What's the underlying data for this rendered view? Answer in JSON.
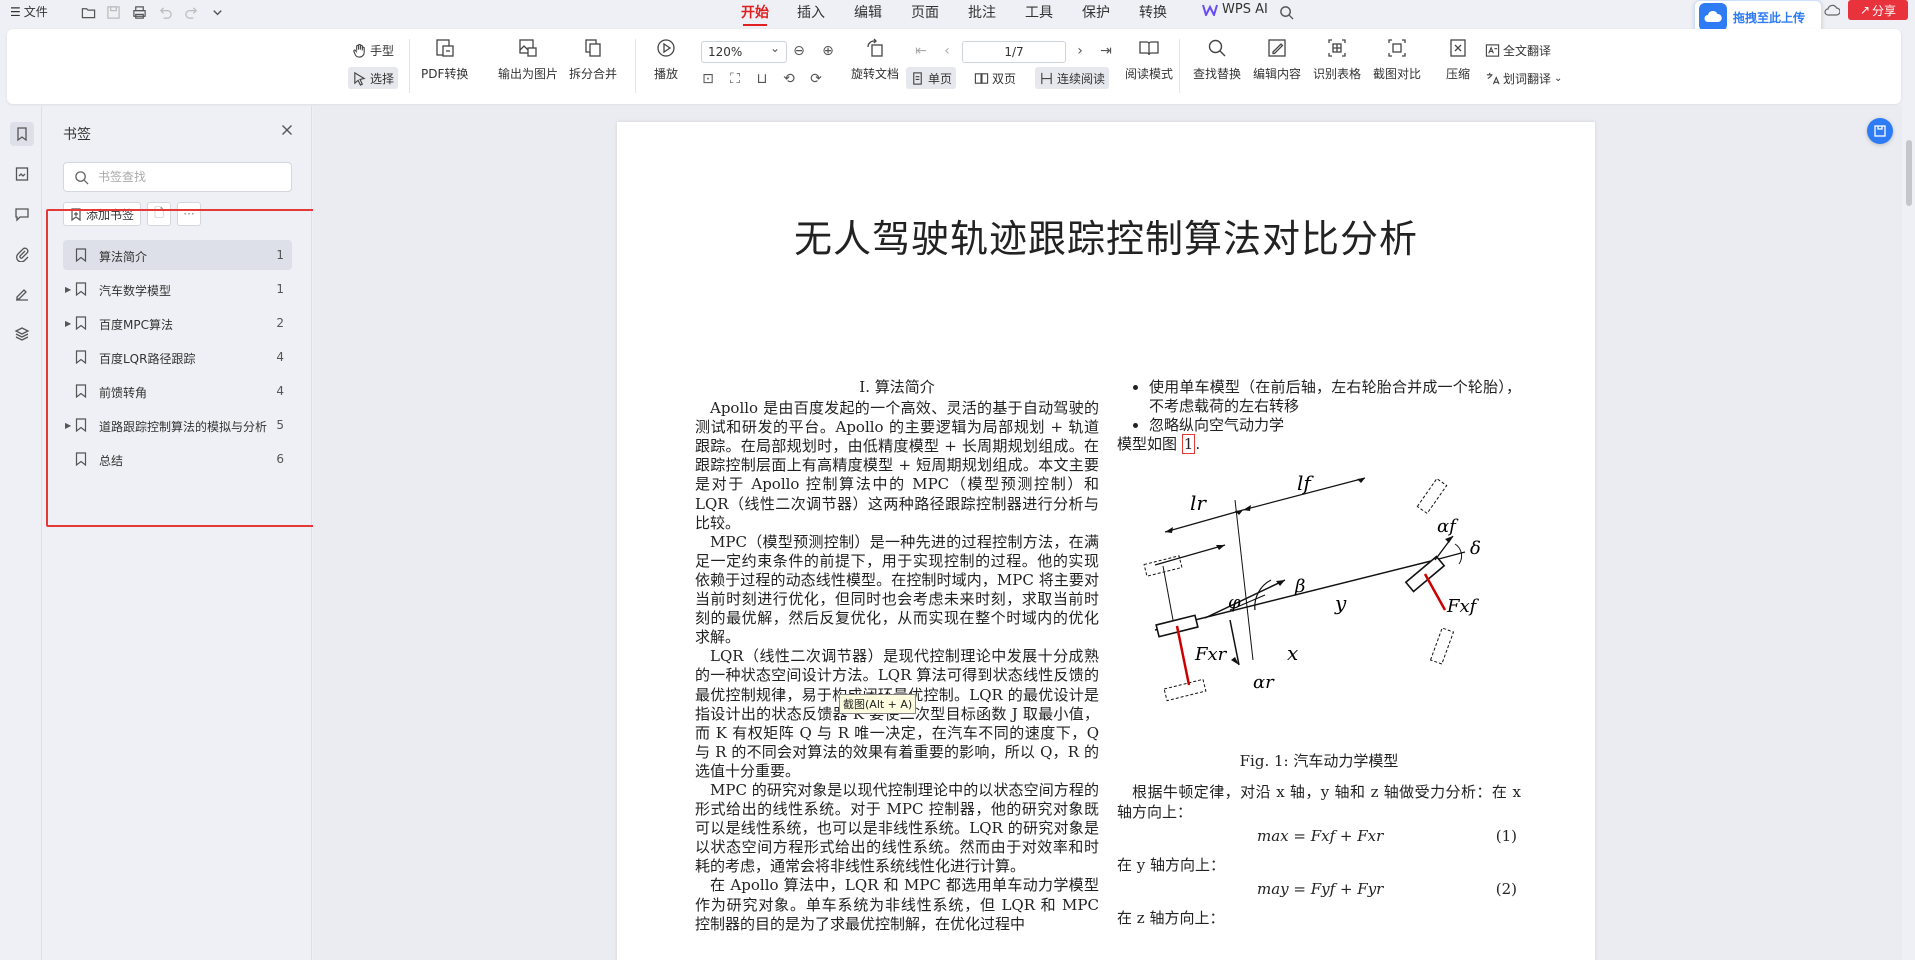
{
  "menu": {
    "file_label": "文件",
    "tabs": [
      "开始",
      "插入",
      "编辑",
      "页面",
      "批注",
      "工具",
      "保护",
      "转换"
    ],
    "active_tab": "开始",
    "wps_ai": "WPS AI",
    "upload_label": "拖拽至此上传",
    "share_label": "分享"
  },
  "ribbon": {
    "hand_tool": "手型",
    "select_tool": "选择",
    "pdf_convert": "PDF转换",
    "export_image": "输出为图片",
    "split_merge": "拆分合并",
    "play": "播放",
    "zoom_value": "120%",
    "rotate_doc": "旋转文档",
    "page_value": "1/7",
    "single_page": "单页",
    "double_page": "双页",
    "continuous": "连续阅读",
    "reading_mode": "阅读模式",
    "find_replace": "查找替换",
    "edit_content": "编辑内容",
    "recognize_table": "识别表格",
    "screenshot_compare": "截图对比",
    "compress": "压缩",
    "full_translate": "全文翻译",
    "word_translate": "划词翻译"
  },
  "bookmarks": {
    "title": "书签",
    "search_placeholder": "书签查找",
    "add_label": "添加书签",
    "items": [
      {
        "label": "算法简介",
        "page": "1",
        "expandable": false
      },
      {
        "label": "汽车数学模型",
        "page": "1",
        "expandable": true
      },
      {
        "label": "百度MPC算法",
        "page": "2",
        "expandable": true
      },
      {
        "label": "百度LQR路径跟踪",
        "page": "4",
        "expandable": false
      },
      {
        "label": "前馈转角",
        "page": "4",
        "expandable": false
      },
      {
        "label": "道路跟踪控制算法的模拟与分析",
        "page": "5",
        "expandable": true
      },
      {
        "label": "总结",
        "page": "6",
        "expandable": false
      }
    ]
  },
  "document": {
    "title": "无人驾驶轨迹跟踪控制算法对比分析",
    "section_heading": "I. 算法简介",
    "paragraphs": [
      "Apollo 是由百度发起的一个高效、灵活的基于自动驾驶的测试和研发的平台。Apollo 的主要逻辑为局部规划 + 轨道跟踪。在局部规划时，由低精度模型 + 长周期规划组成。在跟踪控制层面上有高精度模型 + 短周期规划组成。本文主要是对于 Apollo 控制算法中的 MPC（模型预测控制）和 LQR（线性二次调节器）这两种路径跟踪控制器进行分析与比较。",
      "MPC（模型预测控制）是一种先进的过程控制方法，在满足一定约束条件的前提下，用于实现控制的过程。他的实现依赖于过程的动态线性模型。在控制时域内，MPC 将主要对当前时刻进行优化，但同时也会考虑未来时刻，求取当前时刻的最优解，然后反复优化，从而实现在整个时域内的优化求解。",
      "LQR（线性二次调节器）是现代控制理论中发展十分成熟的一种状态空间设计方法。LQR 算法可得到状态线性反馈的最优控制规律，易于构成闭环最优控制。LQR 的最优设计是指设计出的状态反馈器 K 要使二次型目标函数 J 取最小值，而 K 有权矩阵 Q 与 R 唯一决定，在汽车不同的速度下，Q 与 R 的不同会对算法的效果有着重要的影响，所以 Q，R 的选值十分重要。",
      "MPC 的研究对象是以现代控制理论中的以状态空间方程的形式给出的线性系统。对于 MPC 控制器，他的研究对象既可以是线性系统，也可以是非线性系统。LQR 的研究对象是以状态空间方程形式给出的线性系统。然而由于对效率和时耗的考虑，通常会将非线性系统线性化进行计算。",
      "在 Apollo 算法中，LQR 和 MPC 都选用单车动力学模型作为研究对象。单车系统为非线性系统，但 LQR 和 MPC 控制器的目的是为了求最优控制解，在优化过程中"
    ],
    "bullets": [
      "使用单车模型（在前后轴，左右轮胎合并成一个轮胎），不考虑载荷的左右转移",
      "忽略纵向空气动力学"
    ],
    "model_text": "模型如图",
    "model_ref": "1",
    "figure_labels": {
      "lr": "lr",
      "lf": "lf",
      "alpha_f": "αf",
      "delta": "δ",
      "beta": "β",
      "phi": "φ",
      "y": "y",
      "x": "x",
      "fxf": "Fxf",
      "fxr": "Fxr",
      "alpha_r": "αr"
    },
    "figure_caption": "Fig. 1: 汽车动力学模型",
    "analysis_text": "根据牛顿定律，对沿 x 轴，y 轴和 z 轴做受力分析：在 x 轴方向上：",
    "eq1": "max = Fxf + Fxr",
    "eq1_no": "(1)",
    "y_dir": "在 y 轴方向上：",
    "eq2": "may = Fyf + Fyr",
    "eq2_no": "(2)",
    "z_dir": "在 z 轴方向上：",
    "tooltip": "截图(Alt + A)"
  }
}
